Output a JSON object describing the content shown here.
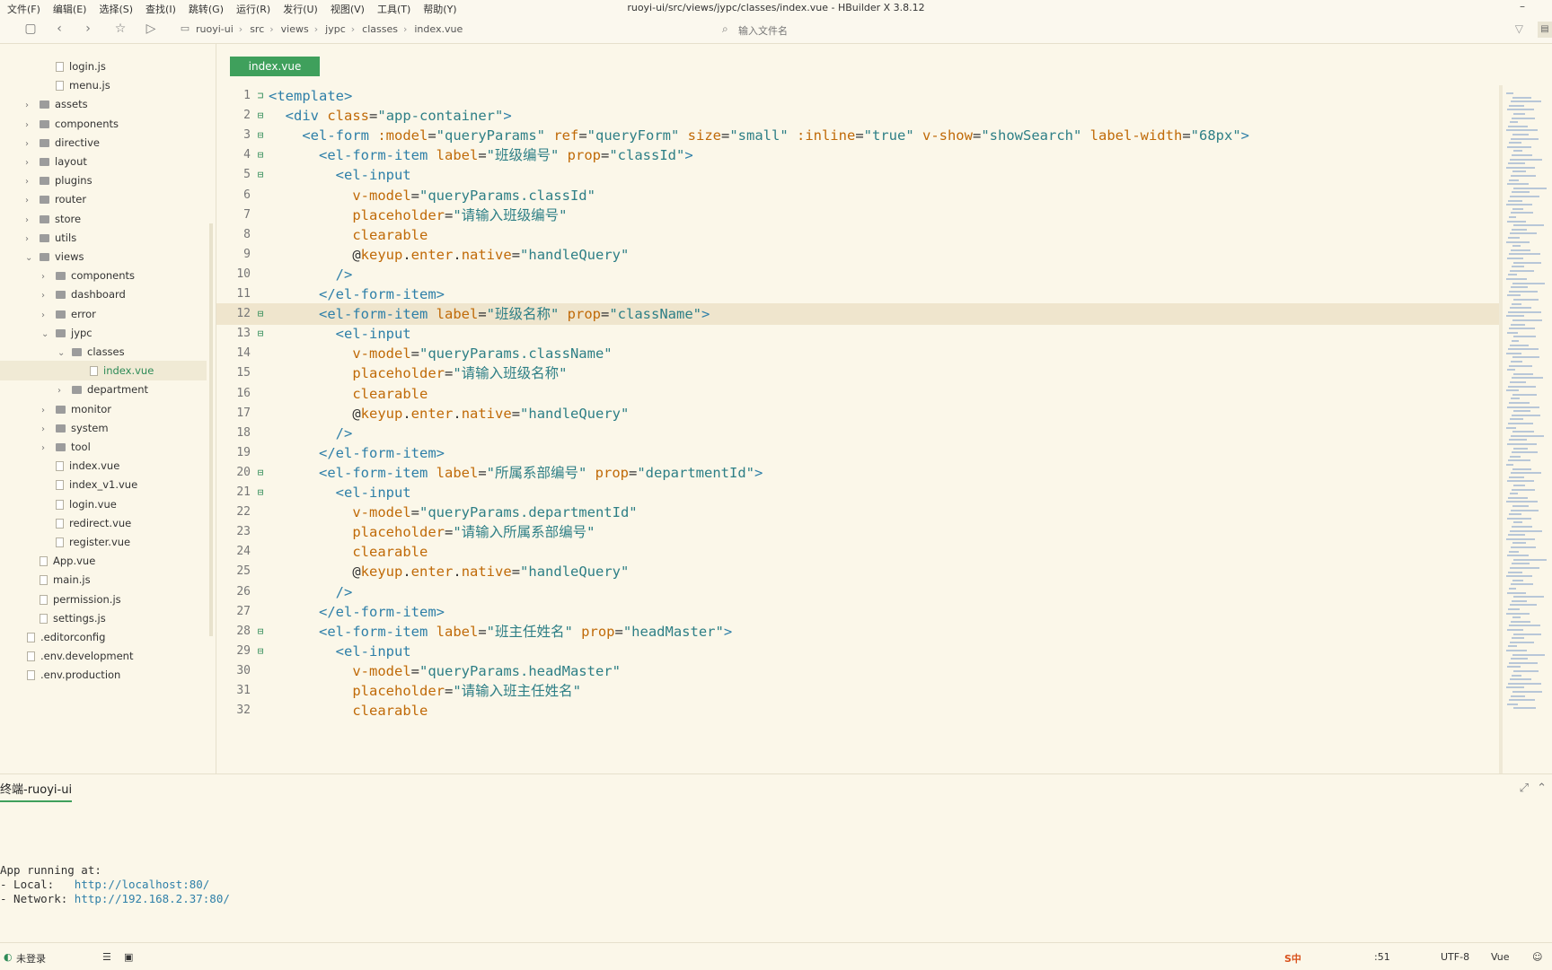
{
  "menu": {
    "items": [
      "文件(F)",
      "编辑(E)",
      "选择(S)",
      "查找(I)",
      "跳转(G)",
      "运行(R)",
      "发行(U)",
      "视图(V)",
      "工具(T)",
      "帮助(Y)"
    ],
    "title": "ruoyi-ui/src/views/jypc/classes/index.vue - HBuilder X 3.8.12"
  },
  "breadcrumb": [
    "ruoyi-ui",
    "src",
    "views",
    "jypc",
    "classes",
    "index.vue"
  ],
  "search": {
    "placeholder": "输入文件名"
  },
  "tree": [
    {
      "label": "login.js",
      "kind": "file",
      "level": 2
    },
    {
      "label": "menu.js",
      "kind": "file",
      "level": 2
    },
    {
      "label": "assets",
      "kind": "folder",
      "level": 1,
      "open": false
    },
    {
      "label": "components",
      "kind": "folder",
      "level": 1,
      "open": false
    },
    {
      "label": "directive",
      "kind": "folder",
      "level": 1,
      "open": false
    },
    {
      "label": "layout",
      "kind": "folder",
      "level": 1,
      "open": false
    },
    {
      "label": "plugins",
      "kind": "folder",
      "level": 1,
      "open": false
    },
    {
      "label": "router",
      "kind": "folder",
      "level": 1,
      "open": false
    },
    {
      "label": "store",
      "kind": "folder",
      "level": 1,
      "open": false
    },
    {
      "label": "utils",
      "kind": "folder",
      "level": 1,
      "open": false
    },
    {
      "label": "views",
      "kind": "folder",
      "level": 1,
      "open": true
    },
    {
      "label": "components",
      "kind": "folder",
      "level": 2,
      "open": false
    },
    {
      "label": "dashboard",
      "kind": "folder",
      "level": 2,
      "open": false
    },
    {
      "label": "error",
      "kind": "folder",
      "level": 2,
      "open": false
    },
    {
      "label": "jypc",
      "kind": "folder",
      "level": 2,
      "open": true
    },
    {
      "label": "classes",
      "kind": "folder",
      "level": 3,
      "open": true
    },
    {
      "label": "index.vue",
      "kind": "file",
      "level": 4,
      "active": true
    },
    {
      "label": "department",
      "kind": "folder",
      "level": 3,
      "open": false
    },
    {
      "label": "monitor",
      "kind": "folder",
      "level": 2,
      "open": false
    },
    {
      "label": "system",
      "kind": "folder",
      "level": 2,
      "open": false
    },
    {
      "label": "tool",
      "kind": "folder",
      "level": 2,
      "open": false
    },
    {
      "label": "index.vue",
      "kind": "file",
      "level": 2
    },
    {
      "label": "index_v1.vue",
      "kind": "file",
      "level": 2
    },
    {
      "label": "login.vue",
      "kind": "file",
      "level": 2
    },
    {
      "label": "redirect.vue",
      "kind": "file",
      "level": 2
    },
    {
      "label": "register.vue",
      "kind": "file",
      "level": 2
    },
    {
      "label": "App.vue",
      "kind": "file",
      "level": 1
    },
    {
      "label": "main.js",
      "kind": "file",
      "level": 1
    },
    {
      "label": "permission.js",
      "kind": "file",
      "level": 1
    },
    {
      "label": "settings.js",
      "kind": "file",
      "level": 1
    },
    {
      "label": ".editorconfig",
      "kind": "file",
      "level": 0
    },
    {
      "label": ".env.development",
      "kind": "file",
      "level": 0
    },
    {
      "label": ".env.production",
      "kind": "file",
      "level": 0
    }
  ],
  "editor": {
    "tab": "index.vue",
    "current_line": 12,
    "lines": [
      {
        "n": "1",
        "fold": "⊐",
        "tokens": [
          [
            "t",
            "<template>"
          ]
        ]
      },
      {
        "n": "2",
        "fold": "⊟",
        "tokens": [
          [
            "p",
            "  "
          ],
          [
            "t",
            "<div "
          ],
          [
            "a",
            "class"
          ],
          [
            "p",
            "="
          ],
          [
            "s",
            "\"app-container\""
          ],
          [
            "t",
            ">"
          ]
        ]
      },
      {
        "n": "3",
        "fold": "⊟",
        "tokens": [
          [
            "p",
            "    "
          ],
          [
            "t",
            "<el-form "
          ],
          [
            "a",
            ":model"
          ],
          [
            "p",
            "="
          ],
          [
            "s",
            "\"queryParams\" "
          ],
          [
            "a",
            "ref"
          ],
          [
            "p",
            "="
          ],
          [
            "s",
            "\"queryForm\" "
          ],
          [
            "a",
            "size"
          ],
          [
            "p",
            "="
          ],
          [
            "s",
            "\"small\" "
          ],
          [
            "a",
            ":inline"
          ],
          [
            "p",
            "="
          ],
          [
            "s",
            "\"true\" "
          ],
          [
            "a",
            "v-show"
          ],
          [
            "p",
            "="
          ],
          [
            "s",
            "\"showSearch\" "
          ],
          [
            "a",
            "label-width"
          ],
          [
            "p",
            "="
          ],
          [
            "s",
            "\"68px\""
          ],
          [
            "t",
            ">"
          ]
        ]
      },
      {
        "n": "4",
        "fold": "⊟",
        "tokens": [
          [
            "p",
            "      "
          ],
          [
            "t",
            "<el-form-item "
          ],
          [
            "a",
            "label"
          ],
          [
            "p",
            "="
          ],
          [
            "s",
            "\"班级编号\" "
          ],
          [
            "a",
            "prop"
          ],
          [
            "p",
            "="
          ],
          [
            "s",
            "\"classId\""
          ],
          [
            "t",
            ">"
          ]
        ]
      },
      {
        "n": "5",
        "fold": "⊟",
        "tokens": [
          [
            "p",
            "        "
          ],
          [
            "t",
            "<el-input"
          ]
        ]
      },
      {
        "n": "6",
        "fold": "",
        "tokens": [
          [
            "p",
            "          "
          ],
          [
            "a",
            "v-model"
          ],
          [
            "p",
            "="
          ],
          [
            "s",
            "\"queryParams.classId\""
          ]
        ]
      },
      {
        "n": "7",
        "fold": "",
        "tokens": [
          [
            "p",
            "          "
          ],
          [
            "a",
            "placeholder"
          ],
          [
            "p",
            "="
          ],
          [
            "s",
            "\"请输入班级编号\""
          ]
        ]
      },
      {
        "n": "8",
        "fold": "",
        "tokens": [
          [
            "p",
            "          "
          ],
          [
            "a",
            "clearable"
          ]
        ]
      },
      {
        "n": "9",
        "fold": "",
        "tokens": [
          [
            "p",
            "          @"
          ],
          [
            "a",
            "keyup"
          ],
          [
            "p",
            "."
          ],
          [
            "a",
            "enter"
          ],
          [
            "p",
            "."
          ],
          [
            "a",
            "native"
          ],
          [
            "p",
            "="
          ],
          [
            "s",
            "\"handleQuery\""
          ]
        ]
      },
      {
        "n": "10",
        "fold": "",
        "tokens": [
          [
            "p",
            "        "
          ],
          [
            "t",
            "/>"
          ]
        ]
      },
      {
        "n": "11",
        "fold": "",
        "tokens": [
          [
            "p",
            "      "
          ],
          [
            "t",
            "</el-form-item>"
          ]
        ]
      },
      {
        "n": "12",
        "fold": "⊟",
        "tokens": [
          [
            "p",
            "      "
          ],
          [
            "t",
            "<el-form-item "
          ],
          [
            "a",
            "label"
          ],
          [
            "p",
            "="
          ],
          [
            "s",
            "\"班级名称\" "
          ],
          [
            "a",
            "prop"
          ],
          [
            "p",
            "="
          ],
          [
            "s",
            "\"className\""
          ],
          [
            "t",
            ">"
          ]
        ]
      },
      {
        "n": "13",
        "fold": "⊟",
        "tokens": [
          [
            "p",
            "        "
          ],
          [
            "t",
            "<el-input"
          ]
        ]
      },
      {
        "n": "14",
        "fold": "",
        "tokens": [
          [
            "p",
            "          "
          ],
          [
            "a",
            "v-model"
          ],
          [
            "p",
            "="
          ],
          [
            "s",
            "\"queryParams.className\""
          ]
        ]
      },
      {
        "n": "15",
        "fold": "",
        "tokens": [
          [
            "p",
            "          "
          ],
          [
            "a",
            "placeholder"
          ],
          [
            "p",
            "="
          ],
          [
            "s",
            "\"请输入班级名称\""
          ]
        ]
      },
      {
        "n": "16",
        "fold": "",
        "tokens": [
          [
            "p",
            "          "
          ],
          [
            "a",
            "clearable"
          ]
        ]
      },
      {
        "n": "17",
        "fold": "",
        "tokens": [
          [
            "p",
            "          @"
          ],
          [
            "a",
            "keyup"
          ],
          [
            "p",
            "."
          ],
          [
            "a",
            "enter"
          ],
          [
            "p",
            "."
          ],
          [
            "a",
            "native"
          ],
          [
            "p",
            "="
          ],
          [
            "s",
            "\"handleQuery\""
          ]
        ]
      },
      {
        "n": "18",
        "fold": "",
        "tokens": [
          [
            "p",
            "        "
          ],
          [
            "t",
            "/>"
          ]
        ]
      },
      {
        "n": "19",
        "fold": "",
        "tokens": [
          [
            "p",
            "      "
          ],
          [
            "t",
            "</el-form-item>"
          ]
        ]
      },
      {
        "n": "20",
        "fold": "⊟",
        "tokens": [
          [
            "p",
            "      "
          ],
          [
            "t",
            "<el-form-item "
          ],
          [
            "a",
            "label"
          ],
          [
            "p",
            "="
          ],
          [
            "s",
            "\"所属系部编号\" "
          ],
          [
            "a",
            "prop"
          ],
          [
            "p",
            "="
          ],
          [
            "s",
            "\"departmentId\""
          ],
          [
            "t",
            ">"
          ]
        ]
      },
      {
        "n": "21",
        "fold": "⊟",
        "tokens": [
          [
            "p",
            "        "
          ],
          [
            "t",
            "<el-input"
          ]
        ]
      },
      {
        "n": "22",
        "fold": "",
        "tokens": [
          [
            "p",
            "          "
          ],
          [
            "a",
            "v-model"
          ],
          [
            "p",
            "="
          ],
          [
            "s",
            "\"queryParams.departmentId\""
          ]
        ]
      },
      {
        "n": "23",
        "fold": "",
        "tokens": [
          [
            "p",
            "          "
          ],
          [
            "a",
            "placeholder"
          ],
          [
            "p",
            "="
          ],
          [
            "s",
            "\"请输入所属系部编号\""
          ]
        ]
      },
      {
        "n": "24",
        "fold": "",
        "tokens": [
          [
            "p",
            "          "
          ],
          [
            "a",
            "clearable"
          ]
        ]
      },
      {
        "n": "25",
        "fold": "",
        "tokens": [
          [
            "p",
            "          @"
          ],
          [
            "a",
            "keyup"
          ],
          [
            "p",
            "."
          ],
          [
            "a",
            "enter"
          ],
          [
            "p",
            "."
          ],
          [
            "a",
            "native"
          ],
          [
            "p",
            "="
          ],
          [
            "s",
            "\"handleQuery\""
          ]
        ]
      },
      {
        "n": "26",
        "fold": "",
        "tokens": [
          [
            "p",
            "        "
          ],
          [
            "t",
            "/>"
          ]
        ]
      },
      {
        "n": "27",
        "fold": "",
        "tokens": [
          [
            "p",
            "      "
          ],
          [
            "t",
            "</el-form-item>"
          ]
        ]
      },
      {
        "n": "28",
        "fold": "⊟",
        "tokens": [
          [
            "p",
            "      "
          ],
          [
            "t",
            "<el-form-item "
          ],
          [
            "a",
            "label"
          ],
          [
            "p",
            "="
          ],
          [
            "s",
            "\"班主任姓名\" "
          ],
          [
            "a",
            "prop"
          ],
          [
            "p",
            "="
          ],
          [
            "s",
            "\"headMaster\""
          ],
          [
            "t",
            ">"
          ]
        ]
      },
      {
        "n": "29",
        "fold": "⊟",
        "tokens": [
          [
            "p",
            "        "
          ],
          [
            "t",
            "<el-input"
          ]
        ]
      },
      {
        "n": "30",
        "fold": "",
        "tokens": [
          [
            "p",
            "          "
          ],
          [
            "a",
            "v-model"
          ],
          [
            "p",
            "="
          ],
          [
            "s",
            "\"queryParams.headMaster\""
          ]
        ]
      },
      {
        "n": "31",
        "fold": "",
        "tokens": [
          [
            "p",
            "          "
          ],
          [
            "a",
            "placeholder"
          ],
          [
            "p",
            "="
          ],
          [
            "s",
            "\"请输入班主任姓名\""
          ]
        ]
      },
      {
        "n": "32",
        "fold": "",
        "tokens": [
          [
            "p",
            "          "
          ],
          [
            "a",
            "clearable"
          ]
        ]
      }
    ]
  },
  "terminal": {
    "tab": "终端-ruoyi-ui",
    "lines": [
      {
        "text": "App running at:",
        "url": ""
      },
      {
        "text": "- Local:   ",
        "url": "http://localhost:80/"
      },
      {
        "text": "- Network: ",
        "url": "http://192.168.2.37:80/"
      }
    ]
  },
  "status": {
    "login": "未登录",
    "time": ":51",
    "encoding": "UTF-8",
    "language": "Vue"
  },
  "colors": {
    "accent": "#3fa05c",
    "background": "#fbf7e9",
    "tag": "#2e7fa8",
    "attribute": "#c06a08",
    "string": "#2e7f86"
  }
}
